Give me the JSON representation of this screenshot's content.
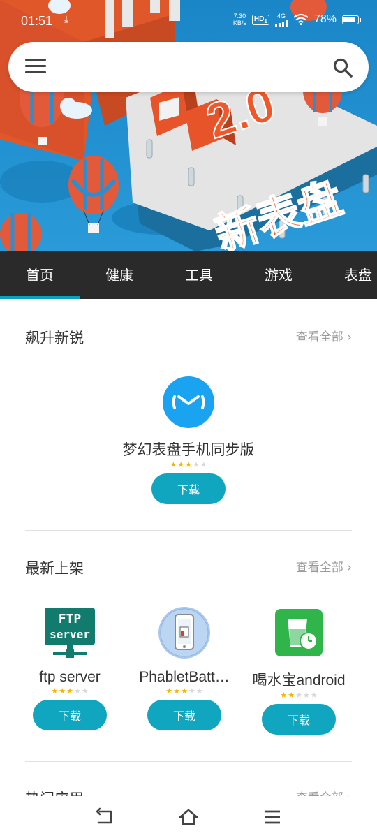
{
  "status_bar": {
    "time": "01:51",
    "net_speed_value": "7.30",
    "net_speed_unit": "KB/s",
    "hd_label": "HD",
    "hd_sim": "1",
    "signal_label": "4G",
    "battery_percent": "78%"
  },
  "banner": {
    "headline_top": "2.0",
    "headline_bottom": "新表盘"
  },
  "search": {
    "placeholder": ""
  },
  "tabs": [
    {
      "label": "首页",
      "active": true
    },
    {
      "label": "健康"
    },
    {
      "label": "工具"
    },
    {
      "label": "游戏"
    },
    {
      "label": "表盘"
    }
  ],
  "sections": {
    "rising": {
      "title": "飙升新锐",
      "see_all": "查看全部",
      "apps": [
        {
          "name": "梦幻表盘手机同步版",
          "rating": 3,
          "download_label": "下载",
          "icon": "dreamwatch-icon"
        }
      ]
    },
    "newest": {
      "title": "最新上架",
      "see_all": "查看全部",
      "apps": [
        {
          "name": "ftp server",
          "rating": 3,
          "download_label": "下载",
          "icon": "ftp-server-icon",
          "icon_text_1": "FTP",
          "icon_text_2": "server"
        },
        {
          "name": "PhabletBatt…",
          "rating": 3,
          "download_label": "下载",
          "icon": "phablet-battery-icon"
        },
        {
          "name": "喝水宝android",
          "rating": 2,
          "download_label": "下载",
          "icon": "water-cup-icon"
        }
      ]
    },
    "hot": {
      "title": "热门应用",
      "see_all": "查看全部"
    }
  },
  "colors": {
    "accent": "#11a6bf",
    "tabbar_bg": "#2a2a2a",
    "star_on": "#f6b400",
    "star_off": "#d8d8d8"
  }
}
